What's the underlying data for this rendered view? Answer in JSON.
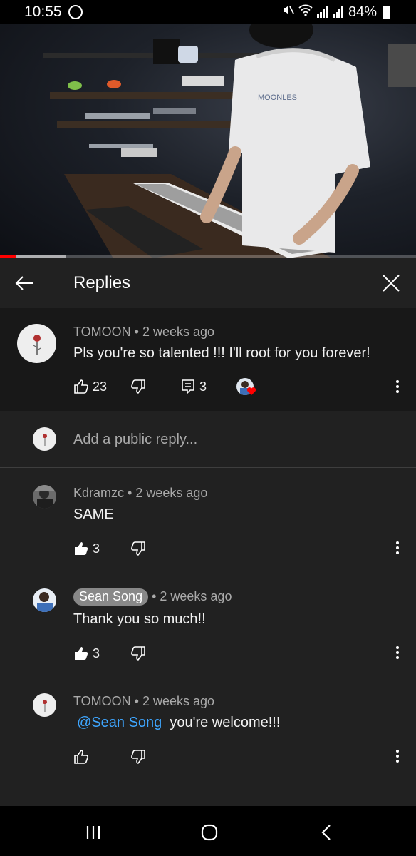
{
  "status_bar": {
    "time": "10:55",
    "battery": "84%"
  },
  "video": {
    "progress": 0.04,
    "buffered": 0.16,
    "shirt_text": "MOONLES"
  },
  "header": {
    "title": "Replies"
  },
  "parent_comment": {
    "author": "TOMOON",
    "age": "2 weeks ago",
    "text": "Pls you're so talented !!! I'll root for you forever!",
    "likes": "23",
    "replies": "3"
  },
  "reply_box": {
    "placeholder": "Add a public reply..."
  },
  "replies": [
    {
      "author": "Kdramzc",
      "age": "2 weeks ago",
      "text": "SAME",
      "likes": "3"
    },
    {
      "author": "Sean Song",
      "age": "2 weeks ago",
      "text": "Thank you so much!!",
      "likes": "3"
    },
    {
      "author": "TOMOON",
      "age": "2 weeks ago",
      "mention": "@Sean Song",
      "text": "you're welcome!!!",
      "likes": ""
    }
  ],
  "colors": {
    "accent_red": "#ff0000",
    "link_blue": "#3ea6ff",
    "bg": "#212121",
    "parent_bg": "#181818"
  }
}
